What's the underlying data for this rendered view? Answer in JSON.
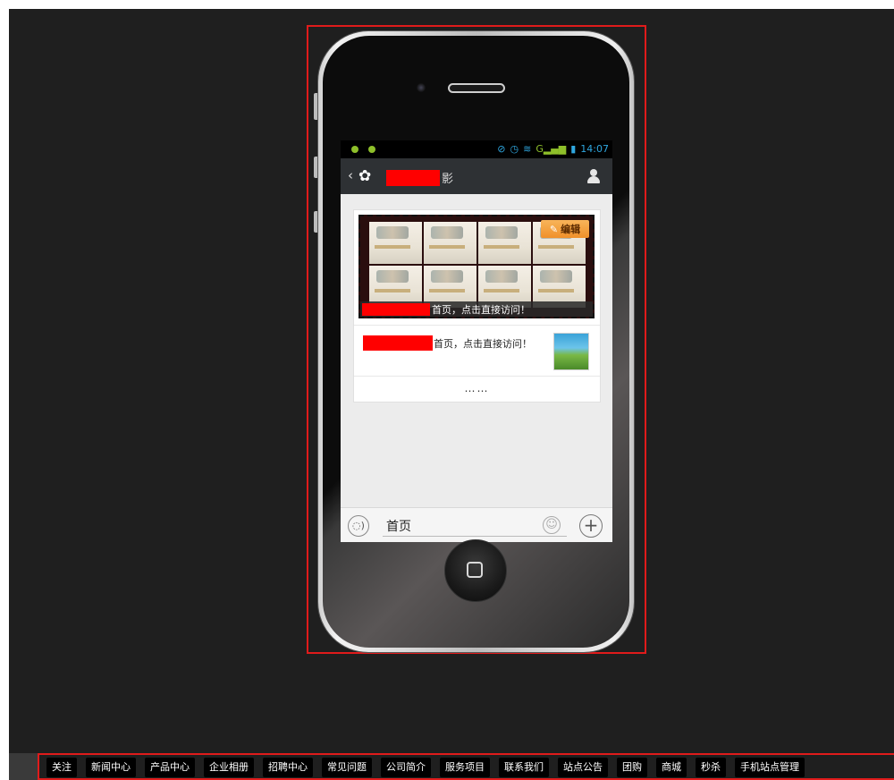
{
  "status_bar": {
    "time": "14:07",
    "icons": [
      "sync-icon",
      "alarm-icon",
      "wifi-icon",
      "signal-icon",
      "battery-icon"
    ]
  },
  "nav_bar": {
    "back_glyph": "‹",
    "title_suffix": "影"
  },
  "card": {
    "edit_label": "编辑",
    "banner_caption": "首页，点击直接访问！",
    "item_text": "首页，点击直接访问！",
    "more_text": "……"
  },
  "input_bar": {
    "value": "首页"
  },
  "bottom_nav": {
    "items": [
      "关注",
      "新闻中心",
      "产品中心",
      "企业相册",
      "招聘中心",
      "常见问题",
      "公司简介",
      "服务项目",
      "联系我们",
      "站点公告",
      "团购",
      "商城",
      "秒杀",
      "手机站点管理"
    ]
  },
  "colors": {
    "highlight": "#e01b1b",
    "redaction": "#ff0000",
    "edit_button": "#f0902a",
    "status_text": "#2fa7e0"
  }
}
